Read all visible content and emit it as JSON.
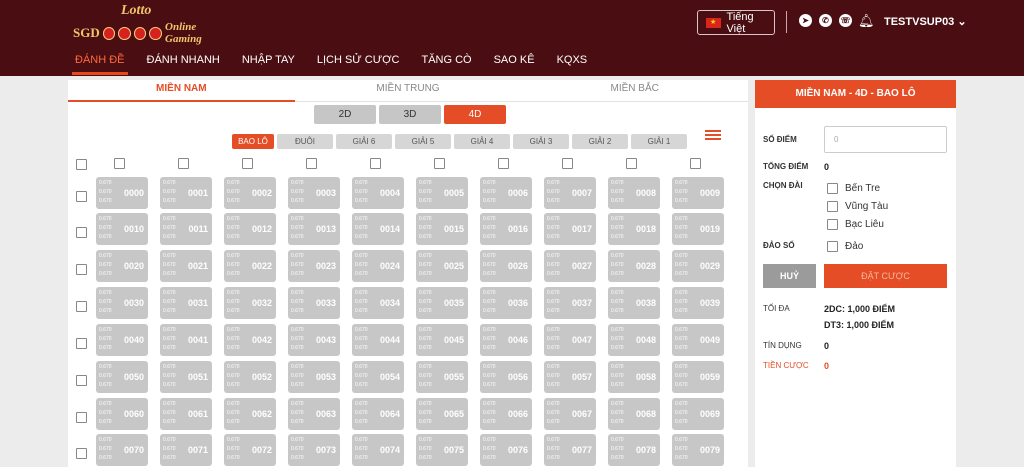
{
  "header": {
    "logo": {
      "top": "Lotto",
      "left": "SGD",
      "right": "Online Gaming"
    },
    "language": "Tiếng Việt",
    "username": "TESTVSUP03",
    "nav": [
      "ĐÁNH ĐỀ",
      "ĐÁNH NHANH",
      "NHẬP TAY",
      "LỊCH SỬ CƯỢC",
      "TĂNG CÒ",
      "SAO KÊ",
      "KQXS"
    ],
    "active_nav": "ĐÁNH ĐỀ"
  },
  "regions": [
    "MIỀN NAM",
    "MIỀN TRUNG",
    "MIỀN BẮC"
  ],
  "active_region": "MIỀN NAM",
  "types": [
    "2D",
    "3D",
    "4D"
  ],
  "active_type": "4D",
  "subtypes": [
    "BAO LÔ",
    "ĐUÔI",
    "GIẢI 6",
    "GIẢI 5",
    "GIẢI 4",
    "GIẢI 3",
    "GIẢI 2",
    "GIẢI 1"
  ],
  "active_subtype": "BAO LÔ",
  "grid": {
    "odds": [
      "0.670",
      "0.670",
      "0.670"
    ],
    "rows": [
      [
        "0000",
        "0001",
        "0002",
        "0003",
        "0004",
        "0005",
        "0006",
        "0007",
        "0008",
        "0009"
      ],
      [
        "0010",
        "0011",
        "0012",
        "0013",
        "0014",
        "0015",
        "0016",
        "0017",
        "0018",
        "0019"
      ],
      [
        "0020",
        "0021",
        "0022",
        "0023",
        "0024",
        "0025",
        "0026",
        "0027",
        "0028",
        "0029"
      ],
      [
        "0030",
        "0031",
        "0032",
        "0033",
        "0034",
        "0035",
        "0036",
        "0037",
        "0038",
        "0039"
      ],
      [
        "0040",
        "0041",
        "0042",
        "0043",
        "0044",
        "0045",
        "0046",
        "0047",
        "0048",
        "0049"
      ],
      [
        "0050",
        "0051",
        "0052",
        "0053",
        "0054",
        "0055",
        "0056",
        "0057",
        "0058",
        "0059"
      ],
      [
        "0060",
        "0061",
        "0062",
        "0063",
        "0064",
        "0065",
        "0066",
        "0067",
        "0068",
        "0069"
      ],
      [
        "0070",
        "0071",
        "0072",
        "0073",
        "0074",
        "0075",
        "0076",
        "0077",
        "0078",
        "0079"
      ]
    ]
  },
  "panel": {
    "title": "MIỀN NAM - 4D - BAO LÔ",
    "score_label": "SỐ ĐIỂM",
    "score_placeholder": "0",
    "total_label": "TỔNG ĐIỂM",
    "total_value": "0",
    "station_label": "CHỌN ĐÀI",
    "stations": [
      "Bến Tre",
      "Vũng Tàu",
      "Bạc Liêu"
    ],
    "reverse_label": "ĐẢO SỐ",
    "reverse_option": "Đảo",
    "cancel": "HUỶ",
    "bet": "ĐẶT CƯỢC",
    "max_label": "TỐI ĐA",
    "max_lines": [
      "2DC: 1,000 ĐIỂM",
      "DT3: 1,000 ĐIỂM"
    ],
    "credit_label": "TÍN DỤNG",
    "credit_value": "0",
    "bet_money_label": "TIỀN CƯỢC",
    "bet_money_value": "0"
  },
  "colors": {
    "header": "#4a0d12",
    "accent": "#e44d26",
    "cell": "#c7c7c7"
  }
}
